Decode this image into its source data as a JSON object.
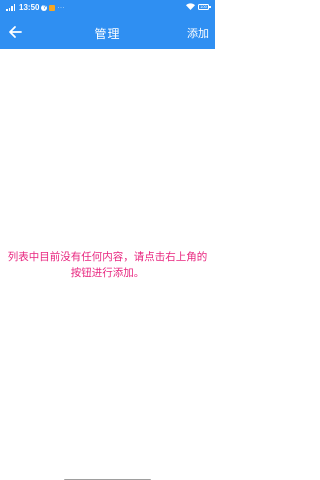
{
  "status_bar": {
    "network": "4G",
    "time": "13:50",
    "battery": "100"
  },
  "app_bar": {
    "title": "管理",
    "add_label": "添加",
    "back_icon": "arrow-left-icon"
  },
  "empty_state": {
    "message": "列表中目前没有任何内容，请点击右上角的按钮进行添加。",
    "color": "#e8267f"
  },
  "colors": {
    "header": "#2f8ff2",
    "background": "#ffffff"
  }
}
